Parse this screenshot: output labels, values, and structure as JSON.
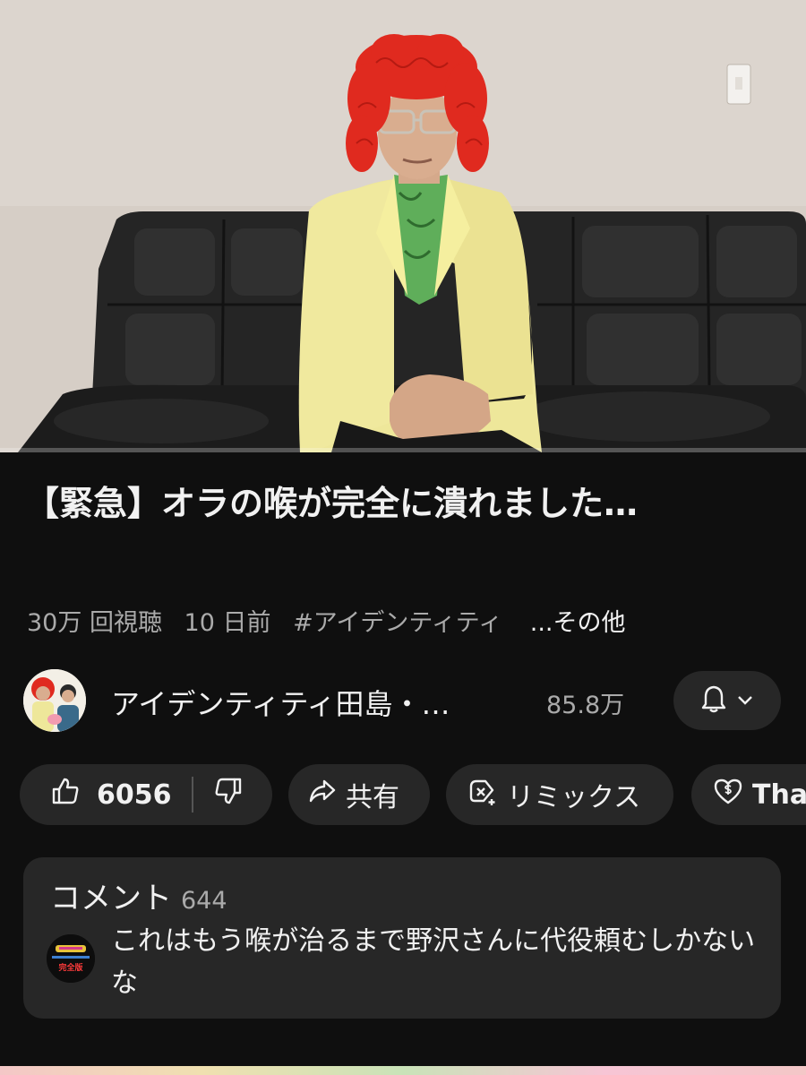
{
  "video": {
    "progress_fraction": 0.0
  },
  "title": "【緊急】オラの喉が完全に潰れました…",
  "meta": {
    "views": "30万 回視聴",
    "age": "10 日前",
    "hashtag": "#アイデンティティ",
    "more": "...その他"
  },
  "channel": {
    "name": "アイデンティティ田島・…",
    "subscribers": "85.8万",
    "bell_icon": "bell-icon",
    "chevron_icon": "chevron-down-icon"
  },
  "actions": {
    "like_count": "6056",
    "share_label": "共有",
    "remix_label": "リミックス",
    "thanks_label": "Thanks"
  },
  "comments": {
    "header": "コメント",
    "count": "644",
    "top_comment": "これはもう喉が治るまで野沢さんに代役頼むしかないな",
    "commenter_avatar_text": "完全版"
  },
  "colors": {
    "background": "#0f0f0f",
    "pill": "#272727",
    "secondary_text": "#aaaaaa",
    "accent": "#ff0000"
  }
}
